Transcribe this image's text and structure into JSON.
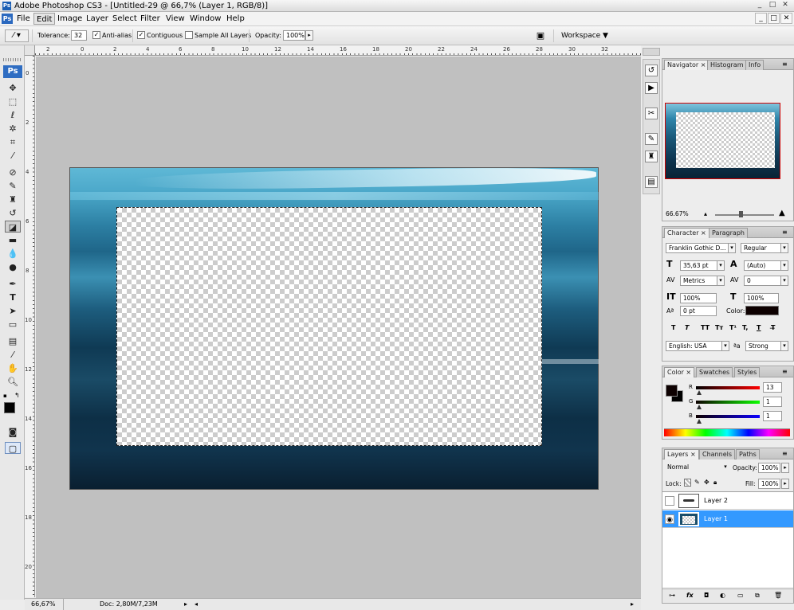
{
  "window": {
    "app_icon": "Ps",
    "title": "Adobe Photoshop CS3 - [Untitled-29 @ 66,7% (Layer 1, RGB/8)]",
    "controls": [
      "_",
      "□",
      "✕"
    ]
  },
  "menubar": {
    "logo": "Ps",
    "items": [
      "File",
      "Edit",
      "Image",
      "Layer",
      "Select",
      "Filter",
      "View",
      "Window",
      "Help"
    ],
    "active_item": "Edit",
    "doc_controls": [
      "_",
      "□",
      "✕"
    ]
  },
  "options": {
    "tool_icon": "magic-wand-icon",
    "tolerance_label": "Tolerance:",
    "tolerance_value": "32",
    "antialias_label": "Anti-alias",
    "antialias_checked": "✓",
    "contiguous_label": "Contiguous",
    "contiguous_checked": "✓",
    "sample_all_label": "Sample All Layers",
    "opacity_label": "Opacity:",
    "opacity_value": "100%",
    "workspace_label": "Workspace ▼"
  },
  "rulers": {
    "top": [
      "2",
      "0",
      "2",
      "4",
      "6",
      "8",
      "10",
      "12",
      "14",
      "16",
      "18",
      "20",
      "22",
      "24",
      "26",
      "28",
      "30",
      "32"
    ],
    "left": [
      "0",
      "2",
      "4",
      "6",
      "8",
      "10",
      "12",
      "14",
      "16",
      "18",
      "20"
    ]
  },
  "statusbar": {
    "zoom": "66,67%",
    "doc": "Doc: 2,80M/7,23M"
  },
  "navigator_panel": {
    "tabs": [
      "Navigator ×",
      "Histogram",
      "Info"
    ],
    "zoom": "66.67%"
  },
  "character_panel": {
    "tabs": [
      "Character ×",
      "Paragraph"
    ],
    "font_family": "Franklin Gothic D...",
    "font_style": "Regular",
    "font_size": "35,63 pt",
    "leading": "(Auto)",
    "kerning": "Metrics",
    "tracking": "0",
    "vertical_scale": "100%",
    "horizontal_scale": "100%",
    "baseline_shift": "0 pt",
    "color_label": "Color:",
    "color_value": "#0d0000",
    "styles": [
      "T",
      "T",
      "TT",
      "Tт",
      "T¹",
      "T,",
      "T",
      "T̶"
    ],
    "language": "English: USA",
    "aa_icon": "ªa",
    "antialias": "Strong"
  },
  "color_panel": {
    "tabs": [
      "Color ×",
      "Swatches",
      "Styles"
    ],
    "r_label": "R",
    "g_label": "G",
    "b_label": "B",
    "r_value": "13",
    "g_value": "1",
    "b_value": "1"
  },
  "layers_panel": {
    "tabs": [
      "Layers ×",
      "Channels",
      "Paths"
    ],
    "blend_mode": "Normal",
    "opacity_label": "Opacity:",
    "opacity_value": "100%",
    "lock_label": "Lock:",
    "fill_label": "Fill:",
    "fill_value": "100%",
    "layers": [
      {
        "name": "Layer 2",
        "visible": false,
        "selected": false
      },
      {
        "name": "Layer 1",
        "visible": true,
        "selected": true
      }
    ],
    "footer_icons": [
      "link-icon",
      "fx-icon",
      "mask-icon",
      "adjustment-icon",
      "group-icon",
      "new-layer-icon",
      "trash-icon"
    ]
  },
  "colors": {
    "selected_layer": "#3399ff",
    "navigator_frame": "#d00000"
  }
}
